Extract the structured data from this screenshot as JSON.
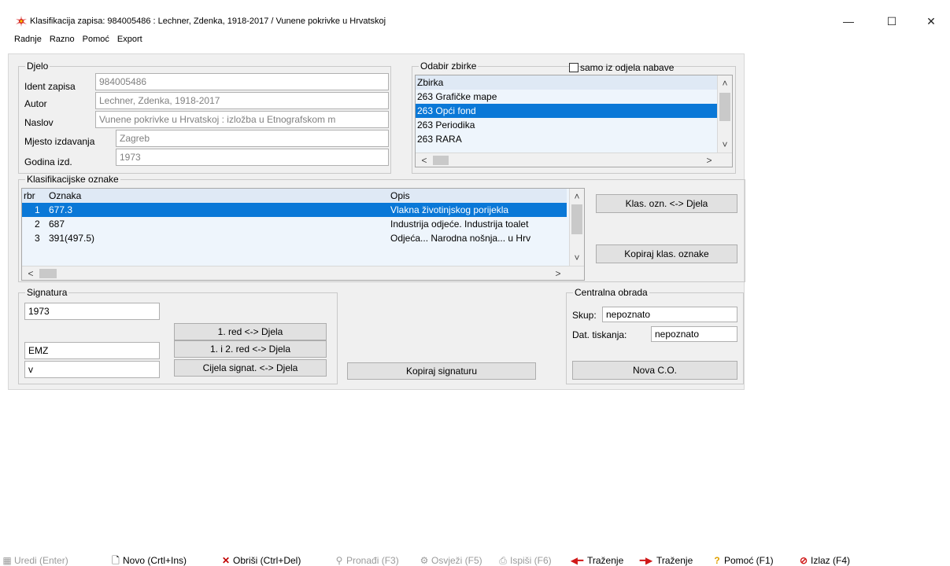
{
  "window": {
    "title": "Klasifikacija zapisa: 984005486 : Lechner, Zdenka, 1918-2017 / Vunene pokrivke u Hrvatskoj",
    "minimize": "—",
    "maximize": "☐",
    "close": "✕"
  },
  "menu": [
    "Radnje",
    "Razno",
    "Pomoć",
    "Export"
  ],
  "djelo": {
    "legend": "Djelo",
    "fields": [
      {
        "label": "Ident zapisa",
        "value": "984005486"
      },
      {
        "label": "Autor",
        "value": "Lechner, Zdenka, 1918-2017"
      },
      {
        "label": "Naslov",
        "value": "Vunene pokrivke u Hrvatskoj : izložba u Etnografskom m"
      },
      {
        "label": "Mjesto izdavanja",
        "value": "Zagreb"
      },
      {
        "label": "Godina izd.",
        "value": "1973"
      }
    ]
  },
  "zbirke": {
    "legend": "Odabir zbirke",
    "checkbox_label": "samo iz odjela nabave",
    "header": "Zbirka",
    "items": [
      "263 Grafičke mape",
      "263 Opći fond",
      "263 Periodika",
      "263 RARA"
    ],
    "selected_index": 1
  },
  "klasifikacija": {
    "legend": "Klasifikacijske oznake",
    "columns": [
      "rbr",
      "Oznaka",
      "Opis"
    ],
    "rows": [
      {
        "rbr": "1",
        "oznaka": "677.3",
        "opis": "Vlakna životinjskog porijekla"
      },
      {
        "rbr": "2",
        "oznaka": "687",
        "opis": "Industrija odjeće. Industrija toalet"
      },
      {
        "rbr": "3",
        "oznaka": "391(497.5)",
        "opis": "Odjeća... Narodna nošnja... u Hrv"
      }
    ],
    "selected_index": 0,
    "buttons": {
      "link": "Klas. ozn. <-> Djela",
      "copy": "Kopiraj klas. oznake"
    }
  },
  "signatura": {
    "legend": "Signatura",
    "values": [
      "1973",
      "EMZ",
      "v"
    ],
    "buttons": [
      "1. red <-> Djela",
      "1. i 2. red <-> Djela",
      "Cijela signat. <-> Djela"
    ],
    "copy": "Kopiraj signaturu"
  },
  "centralna": {
    "legend": "Centralna obrada",
    "skup_label": "Skup:",
    "skup_value": "nepoznato",
    "dat_label": "Dat. tiskanja:",
    "dat_value": "nepoznato",
    "button": "Nova C.O."
  },
  "toolbar": [
    {
      "label": "Uredi (Enter)",
      "icon": "edit-icon",
      "enabled": false
    },
    {
      "label": "Novo (Crtl+Ins)",
      "icon": "new-document-icon",
      "enabled": true
    },
    {
      "label": "Obriši (Ctrl+Del)",
      "icon": "delete-icon",
      "enabled": true
    },
    {
      "label": "Pronađi (F3)",
      "icon": "search-icon",
      "enabled": false
    },
    {
      "label": "Osvježi (F5)",
      "icon": "refresh-icon",
      "enabled": false
    },
    {
      "label": "Ispiši (F6)",
      "icon": "print-icon",
      "enabled": false
    },
    {
      "label": "Traženje",
      "icon": "arrow-left-icon",
      "enabled": true
    },
    {
      "label": "Traženje",
      "icon": "arrow-right-icon",
      "enabled": true
    },
    {
      "label": "Pomoć (F1)",
      "icon": "help-icon",
      "enabled": true
    },
    {
      "label": "Izlaz (F4)",
      "icon": "exit-icon",
      "enabled": true
    }
  ],
  "colors": {
    "selection": "#0a78d7",
    "delete": "#c00000",
    "arrow": "#d01818"
  }
}
